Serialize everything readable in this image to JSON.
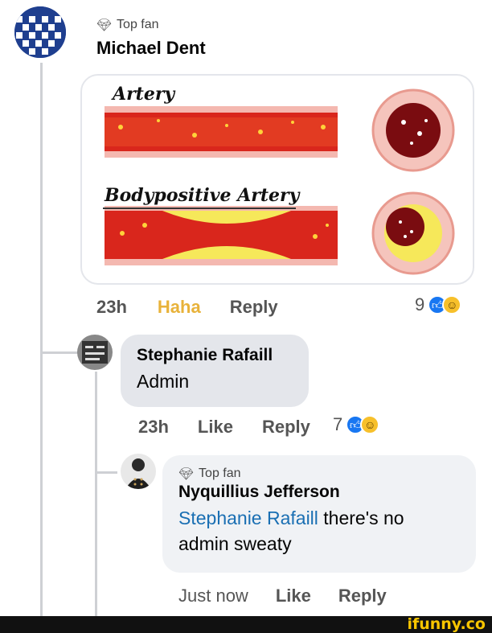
{
  "comment": {
    "badge": "Top fan",
    "author": "Michael Dent",
    "image": {
      "label_top": "Artery",
      "label_bottom": "Bodypositive Artery"
    },
    "time": "23h",
    "haha_label": "Haha",
    "reply_label": "Reply",
    "reaction_count": "9"
  },
  "reply1": {
    "author": "Stephanie Rafaill",
    "text": "Admin",
    "time": "23h",
    "like_label": "Like",
    "reply_label": "Reply",
    "reaction_count": "7"
  },
  "reply2": {
    "badge": "Top fan",
    "author": "Nyquillius Jefferson",
    "mention": "Stephanie Rafaill",
    "text_line1": " there's no",
    "text_line2": "admin sweaty",
    "time": "Just now",
    "like_label": "Like",
    "reply_label": "Reply"
  },
  "watermark": "ifunny.co",
  "colors": {
    "like_blue": "#1877f2",
    "haha_yellow": "#e8b23a",
    "mention_blue": "#1a6fb3",
    "artery_red": "#d9261c"
  },
  "icons": {
    "badge": "diamond-gem-icon",
    "like": "thumbs-up-icon",
    "laugh": "laugh-emoji-icon"
  }
}
